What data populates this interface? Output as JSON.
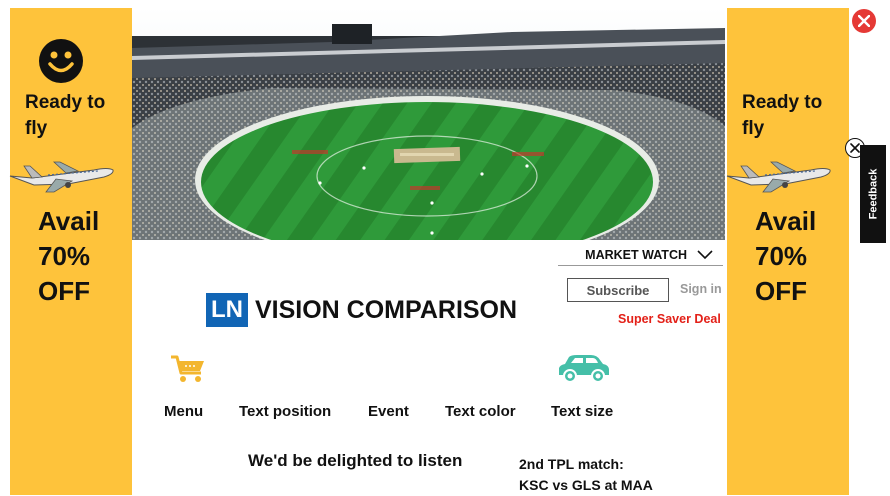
{
  "ads": {
    "left": {
      "tagline": "Ready to fly",
      "offer": "Avail 70% OFF"
    },
    "right": {
      "tagline": "Ready to fly",
      "offer": "Avail 70% OFF"
    },
    "icons": [
      "smiley-icon",
      "airplane-icon"
    ],
    "background": "#fec33b"
  },
  "feedback": {
    "label": "Feedback"
  },
  "header": {
    "market_watch": "MARKET WATCH",
    "subscribe": "Subscribe",
    "sign_in": "Sign in",
    "deal": "Super Saver Deal"
  },
  "brand": {
    "logo": "LN",
    "title": "VISION COMPARISON",
    "logo_color": "#1165b5"
  },
  "nav": {
    "items": [
      {
        "label": "Menu",
        "icon": "cart-icon"
      },
      {
        "label": "Text position"
      },
      {
        "label": "Event"
      },
      {
        "label": "Text color"
      },
      {
        "label": "Text size",
        "icon": "car-icon"
      }
    ]
  },
  "content": {
    "listen": "We'd be delighted to listen",
    "match_line1": "2nd TPL match:",
    "match_line2": "KSC vs GLS at MAA"
  },
  "colors": {
    "deal": "#e32018",
    "car_icon": "#45bfa8",
    "cart_icon": "#f3b62e",
    "close": "#e53935"
  }
}
